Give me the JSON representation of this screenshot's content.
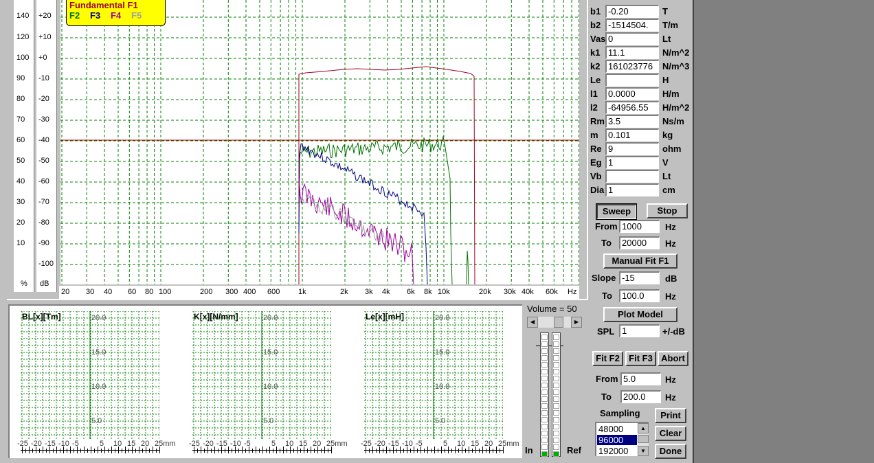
{
  "legend": {
    "fundamental": "Fundamental F1",
    "f2": "F2",
    "f3": "F3",
    "f4": "F4",
    "f5": "F5"
  },
  "colors": {
    "f1": "#a00020",
    "f2": "#007000",
    "f3": "#000080",
    "f4": "#a000a0",
    "f5": "#a0a0a0",
    "grid": "#008000",
    "hline": "#c00000"
  },
  "percent_scale": {
    "ticks": [
      "140",
      "120",
      "100",
      "90",
      "80",
      "70",
      "60",
      "50",
      "40",
      "30",
      "20",
      "10"
    ],
    "unit": "%"
  },
  "db_scale": {
    "ticks": [
      "+20",
      "+10",
      "+0",
      "-10",
      "-20",
      "-30",
      "-40",
      "-50",
      "-60",
      "-70",
      "-80",
      "-90",
      "-100"
    ],
    "unit": "dB"
  },
  "freq_axis": {
    "ticks": [
      "20",
      "30",
      "40",
      "60",
      "80",
      "100",
      "200",
      "300",
      "400",
      "600",
      "1k",
      "2k",
      "3k",
      "4k",
      "6k",
      "8k",
      "10k",
      "20k",
      "30k",
      "40k",
      "60k",
      "Hz"
    ]
  },
  "params": [
    {
      "label": "b1",
      "value": "-0.20",
      "unit": "T"
    },
    {
      "label": "b2",
      "value": "-1514504.",
      "unit": "T/m"
    },
    {
      "label": "Vas",
      "value": "0",
      "unit": "Lt"
    },
    {
      "label": "k1",
      "value": "11.1",
      "unit": "N/m^2"
    },
    {
      "label": "k2",
      "value": "161023776",
      "unit": "N/m^3"
    },
    {
      "label": "Le",
      "value": "",
      "unit": "H"
    },
    {
      "label": "l1",
      "value": "0.0000",
      "unit": "H/m"
    },
    {
      "label": "l2",
      "value": "-64956.55",
      "unit": "H/m^2"
    },
    {
      "label": "Rm",
      "value": "3.5",
      "unit": "Ns/m"
    },
    {
      "label": "m",
      "value": " 0.101",
      "unit": "kg"
    },
    {
      "label": "Re",
      "value": "9",
      "unit": "ohm"
    },
    {
      "label": "Eg",
      "value": "1",
      "unit": "V"
    },
    {
      "label": "Vb",
      "value": "",
      "unit": "Lt"
    },
    {
      "label": "Dia",
      "value": "1",
      "unit": "cm"
    }
  ],
  "sweep": {
    "sweep_label": "Sweep",
    "stop_label": "Stop",
    "from_label": "From",
    "from_value": "1000",
    "to_label": "To",
    "to_value": "20000",
    "unit": "Hz"
  },
  "manual_fit_label": "Manual Fit F1",
  "slope": {
    "label": "Slope",
    "value": "-15",
    "unit": "dB",
    "to_label": "To",
    "to_value": "100.0",
    "to_unit": "Hz"
  },
  "plot_model_label": "Plot Model",
  "spl": {
    "label": "SPL",
    "value": "1",
    "unit": "+/-dB"
  },
  "fit": {
    "f2_label": "Fit F2",
    "f3_label": "Fit F3",
    "abort_label": "Abort",
    "from_label": "From",
    "from_value": "5.0",
    "to_label": "To",
    "to_value": "200.0",
    "unit": "Hz"
  },
  "sampling": {
    "label": "Sampling",
    "options": [
      "48000",
      "96000",
      "192000"
    ],
    "selected": "96000"
  },
  "actions": {
    "print_label": "Print",
    "clear_label": "Clear",
    "done_label": "Done"
  },
  "volume": {
    "label": "Volume = 50",
    "value": 50,
    "in_label": "In",
    "ref_label": "Ref"
  },
  "mini_charts": [
    {
      "title": "BL[x][Tm]"
    },
    {
      "title": "K[x][N/mm]"
    },
    {
      "title": "Le[x][mH]"
    }
  ],
  "mini_y_ticks": [
    "20.0",
    "15.0",
    "10.0",
    "5.0"
  ],
  "mini_x_ticks": [
    "-25",
    "-20",
    "-15",
    "-10",
    "-5",
    "5",
    "10",
    "15",
    "20",
    "25mm"
  ]
}
